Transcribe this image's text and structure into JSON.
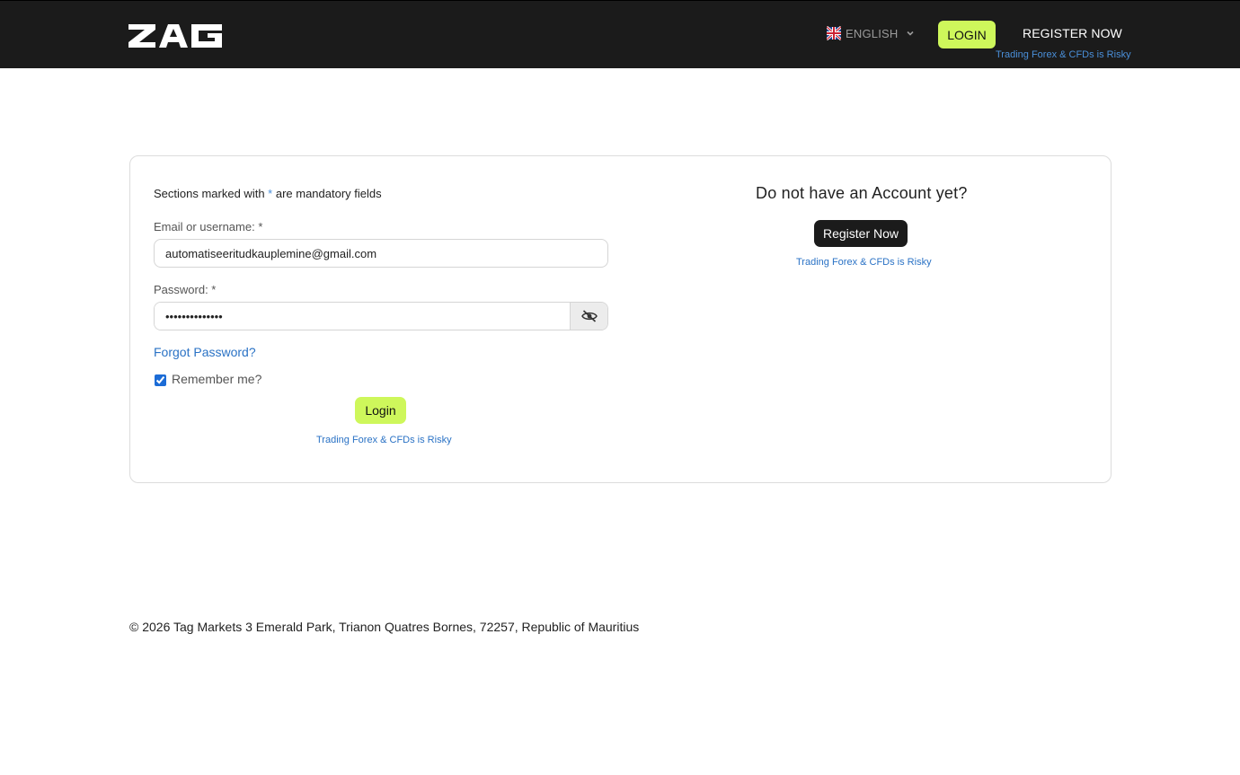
{
  "header": {
    "logo_text": "TAG",
    "language": {
      "label": "ENGLISH",
      "flag_icon": "uk-flag-icon",
      "chevron_icon": "chevron-down-icon"
    },
    "login_label": "LOGIN",
    "register_label": "REGISTER NOW",
    "risk_text": "Trading Forex & CFDs is Risky"
  },
  "login_form": {
    "mandatory_prefix": "Sections marked with ",
    "mandatory_star": "*",
    "mandatory_suffix": " are mandatory fields",
    "email_label": "Email or username: *",
    "email_value": "automatiseeritudkauplemine@gmail.com",
    "password_label": "Password: *",
    "password_value": "••••••••••••••",
    "password_toggle_icon": "eye-slash-icon",
    "forgot_label": "Forgot Password?",
    "remember_label": "Remember me?",
    "remember_checked": true,
    "login_button": "Login",
    "risk_text": "Trading Forex & CFDs is Risky"
  },
  "register_panel": {
    "heading": "Do not have an Account yet?",
    "button": "Register Now",
    "risk_text": "Trading Forex & CFDs is Risky"
  },
  "footer": {
    "text": "© 2026 Tag Markets 3 Emerald Park, Trianon Quatres Bornes, 72257, Republic of Mauritius"
  },
  "colors": {
    "header_bg": "#1b1b1b",
    "accent_lime": "#cef75b",
    "link_blue": "#2a72c5"
  }
}
